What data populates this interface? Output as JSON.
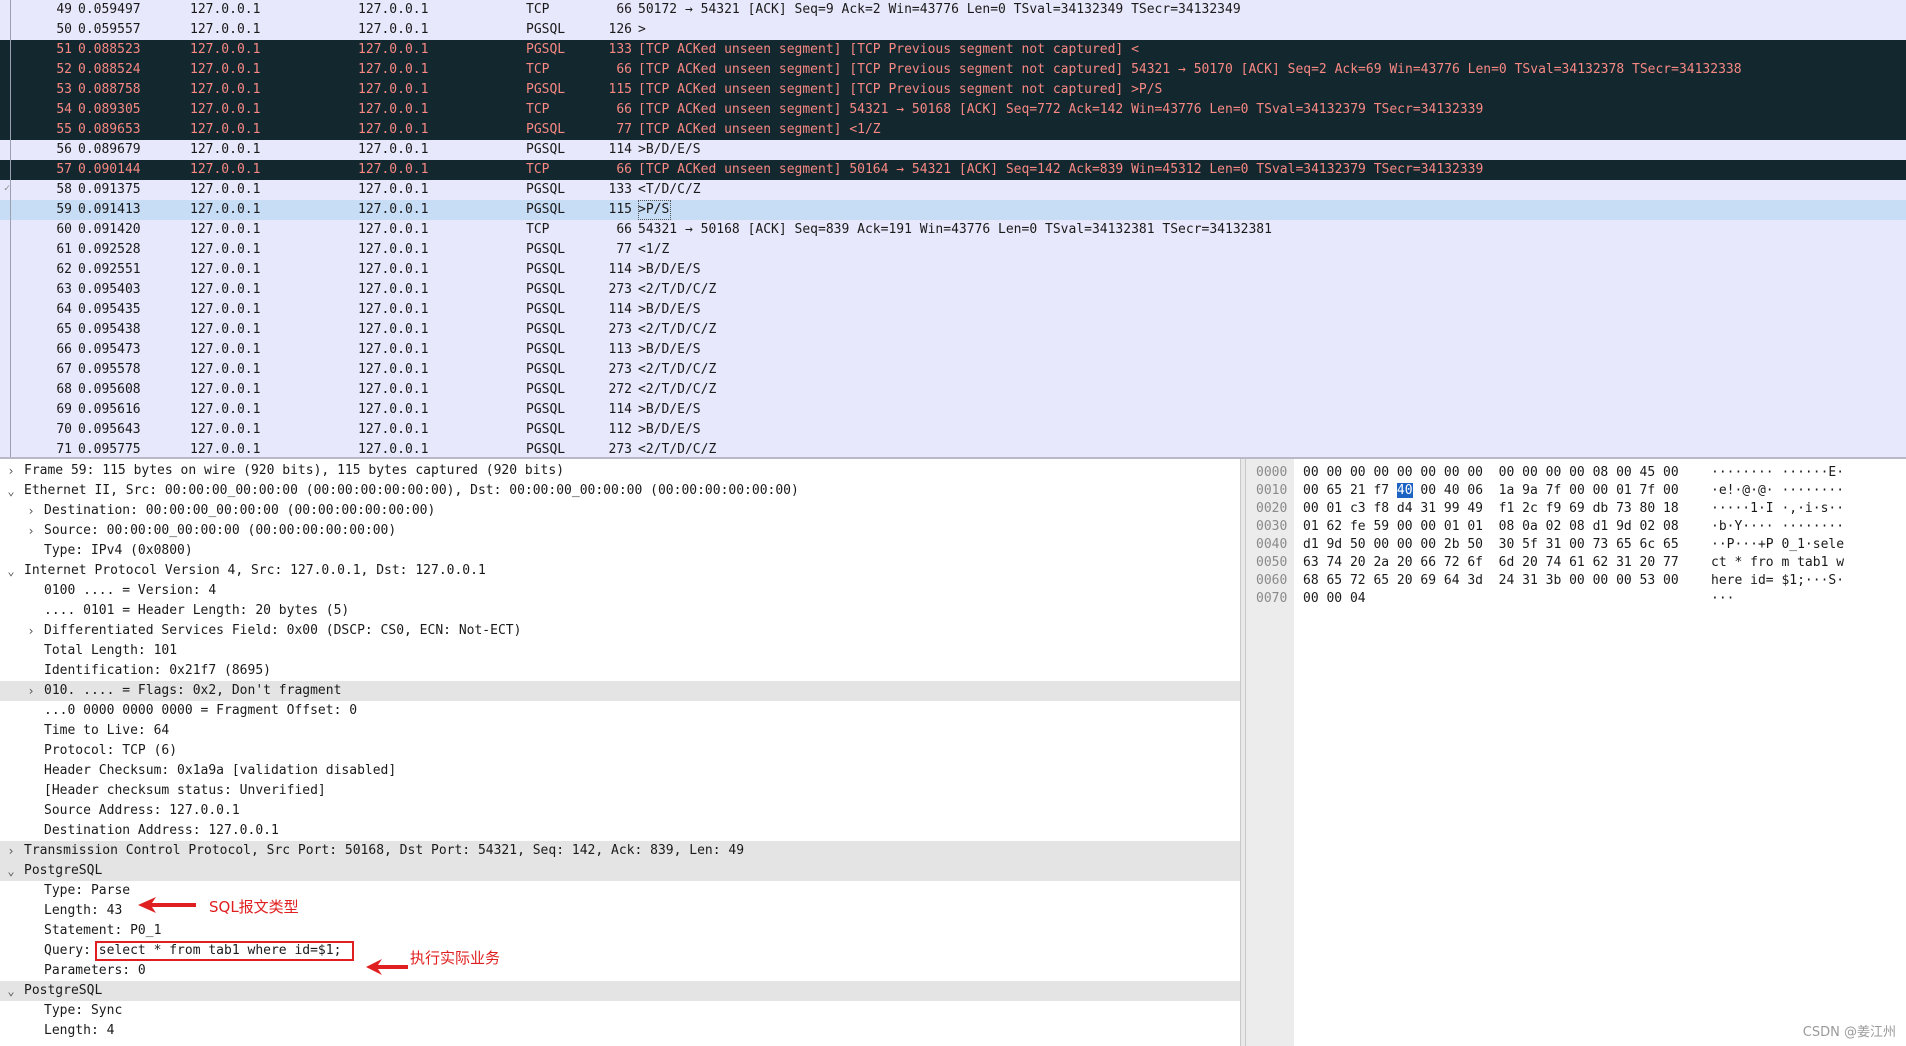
{
  "packet_list": {
    "rows": [
      {
        "no": "49",
        "time": "0.059497",
        "src": "127.0.0.1",
        "dst": "127.0.0.1",
        "proto": "TCP",
        "len": "66",
        "info": "50172 → 54321 [ACK] Seq=9 Ack=2 Win=43776 Len=0 TSval=34132349 TSecr=34132349",
        "style": "normal"
      },
      {
        "no": "50",
        "time": "0.059557",
        "src": "127.0.0.1",
        "dst": "127.0.0.1",
        "proto": "PGSQL",
        "len": "126",
        "info": ">",
        "style": "normal"
      },
      {
        "no": "51",
        "time": "0.088523",
        "src": "127.0.0.1",
        "dst": "127.0.0.1",
        "proto": "PGSQL",
        "len": "133",
        "info": "[TCP ACKed unseen segment] [TCP Previous segment not captured] <",
        "style": "dark"
      },
      {
        "no": "52",
        "time": "0.088524",
        "src": "127.0.0.1",
        "dst": "127.0.0.1",
        "proto": "TCP",
        "len": "66",
        "info": "[TCP ACKed unseen segment] [TCP Previous segment not captured] 54321 → 50170 [ACK] Seq=2 Ack=69 Win=43776 Len=0 TSval=34132378 TSecr=34132338",
        "style": "dark"
      },
      {
        "no": "53",
        "time": "0.088758",
        "src": "127.0.0.1",
        "dst": "127.0.0.1",
        "proto": "PGSQL",
        "len": "115",
        "info": "[TCP ACKed unseen segment] [TCP Previous segment not captured] >P/S",
        "style": "dark"
      },
      {
        "no": "54",
        "time": "0.089305",
        "src": "127.0.0.1",
        "dst": "127.0.0.1",
        "proto": "TCP",
        "len": "66",
        "info": "[TCP ACKed unseen segment] 54321 → 50168 [ACK] Seq=772 Ack=142 Win=43776 Len=0 TSval=34132379 TSecr=34132339",
        "style": "dark"
      },
      {
        "no": "55",
        "time": "0.089653",
        "src": "127.0.0.1",
        "dst": "127.0.0.1",
        "proto": "PGSQL",
        "len": "77",
        "info": "[TCP ACKed unseen segment] <1/Z",
        "style": "dark"
      },
      {
        "no": "56",
        "time": "0.089679",
        "src": "127.0.0.1",
        "dst": "127.0.0.1",
        "proto": "PGSQL",
        "len": "114",
        "info": ">B/D/E/S",
        "style": "normal"
      },
      {
        "no": "57",
        "time": "0.090144",
        "src": "127.0.0.1",
        "dst": "127.0.0.1",
        "proto": "TCP",
        "len": "66",
        "info": "[TCP ACKed unseen segment] 50164 → 54321 [ACK] Seq=142 Ack=839 Win=45312 Len=0 TSval=34132379 TSecr=34132339",
        "style": "dark"
      },
      {
        "no": "58",
        "time": "0.091375",
        "src": "127.0.0.1",
        "dst": "127.0.0.1",
        "proto": "PGSQL",
        "len": "133",
        "info": "<T/D/C/Z",
        "style": "normal"
      },
      {
        "no": "59",
        "time": "0.091413",
        "src": "127.0.0.1",
        "dst": "127.0.0.1",
        "proto": "PGSQL",
        "len": "115",
        "info": ">P/S",
        "style": "sel"
      },
      {
        "no": "60",
        "time": "0.091420",
        "src": "127.0.0.1",
        "dst": "127.0.0.1",
        "proto": "TCP",
        "len": "66",
        "info": "54321 → 50168 [ACK] Seq=839 Ack=191 Win=43776 Len=0 TSval=34132381 TSecr=34132381",
        "style": "normal"
      },
      {
        "no": "61",
        "time": "0.092528",
        "src": "127.0.0.1",
        "dst": "127.0.0.1",
        "proto": "PGSQL",
        "len": "77",
        "info": "<1/Z",
        "style": "normal"
      },
      {
        "no": "62",
        "time": "0.092551",
        "src": "127.0.0.1",
        "dst": "127.0.0.1",
        "proto": "PGSQL",
        "len": "114",
        "info": ">B/D/E/S",
        "style": "normal"
      },
      {
        "no": "63",
        "time": "0.095403",
        "src": "127.0.0.1",
        "dst": "127.0.0.1",
        "proto": "PGSQL",
        "len": "273",
        "info": "<2/T/D/C/Z",
        "style": "normal"
      },
      {
        "no": "64",
        "time": "0.095435",
        "src": "127.0.0.1",
        "dst": "127.0.0.1",
        "proto": "PGSQL",
        "len": "114",
        "info": ">B/D/E/S",
        "style": "normal"
      },
      {
        "no": "65",
        "time": "0.095438",
        "src": "127.0.0.1",
        "dst": "127.0.0.1",
        "proto": "PGSQL",
        "len": "273",
        "info": "<2/T/D/C/Z",
        "style": "normal"
      },
      {
        "no": "66",
        "time": "0.095473",
        "src": "127.0.0.1",
        "dst": "127.0.0.1",
        "proto": "PGSQL",
        "len": "113",
        "info": ">B/D/E/S",
        "style": "normal"
      },
      {
        "no": "67",
        "time": "0.095578",
        "src": "127.0.0.1",
        "dst": "127.0.0.1",
        "proto": "PGSQL",
        "len": "273",
        "info": "<2/T/D/C/Z",
        "style": "normal"
      },
      {
        "no": "68",
        "time": "0.095608",
        "src": "127.0.0.1",
        "dst": "127.0.0.1",
        "proto": "PGSQL",
        "len": "272",
        "info": "<2/T/D/C/Z",
        "style": "normal"
      },
      {
        "no": "69",
        "time": "0.095616",
        "src": "127.0.0.1",
        "dst": "127.0.0.1",
        "proto": "PGSQL",
        "len": "114",
        "info": ">B/D/E/S",
        "style": "normal"
      },
      {
        "no": "70",
        "time": "0.095643",
        "src": "127.0.0.1",
        "dst": "127.0.0.1",
        "proto": "PGSQL",
        "len": "112",
        "info": ">B/D/E/S",
        "style": "normal"
      },
      {
        "no": "71",
        "time": "0.095775",
        "src": "127.0.0.1",
        "dst": "127.0.0.1",
        "proto": "PGSQL",
        "len": "273",
        "info": "<2/T/D/C/Z",
        "style": "normal"
      }
    ]
  },
  "details": {
    "rows": [
      {
        "level": 0,
        "arrow": "right",
        "text": "Frame 59: 115 bytes on wire (920 bits), 115 bytes captured (920 bits)"
      },
      {
        "level": 0,
        "arrow": "down",
        "text": "Ethernet II, Src: 00:00:00_00:00:00 (00:00:00:00:00:00), Dst: 00:00:00_00:00:00 (00:00:00:00:00:00)"
      },
      {
        "level": 1,
        "arrow": "right",
        "text": "Destination: 00:00:00_00:00:00 (00:00:00:00:00:00)"
      },
      {
        "level": 1,
        "arrow": "right",
        "text": "Source: 00:00:00_00:00:00 (00:00:00:00:00:00)"
      },
      {
        "level": 1,
        "arrow": "none",
        "text": "Type: IPv4 (0x0800)"
      },
      {
        "level": 0,
        "arrow": "down",
        "text": "Internet Protocol Version 4, Src: 127.0.0.1, Dst: 127.0.0.1"
      },
      {
        "level": 1,
        "arrow": "none",
        "text": "0100 .... = Version: 4"
      },
      {
        "level": 1,
        "arrow": "none",
        "text": ".... 0101 = Header Length: 20 bytes (5)"
      },
      {
        "level": 1,
        "arrow": "right",
        "text": "Differentiated Services Field: 0x00 (DSCP: CS0, ECN: Not-ECT)"
      },
      {
        "level": 1,
        "arrow": "none",
        "text": "Total Length: 101"
      },
      {
        "level": 1,
        "arrow": "none",
        "text": "Identification: 0x21f7 (8695)"
      },
      {
        "level": 1,
        "arrow": "right",
        "text": "010. .... = Flags: 0x2, Don't fragment",
        "highlight": true
      },
      {
        "level": 1,
        "arrow": "none",
        "text": "...0 0000 0000 0000 = Fragment Offset: 0"
      },
      {
        "level": 1,
        "arrow": "none",
        "text": "Time to Live: 64"
      },
      {
        "level": 1,
        "arrow": "none",
        "text": "Protocol: TCP (6)"
      },
      {
        "level": 1,
        "arrow": "none",
        "text": "Header Checksum: 0x1a9a [validation disabled]"
      },
      {
        "level": 1,
        "arrow": "none",
        "text": "[Header checksum status: Unverified]"
      },
      {
        "level": 1,
        "arrow": "none",
        "text": "Source Address: 127.0.0.1"
      },
      {
        "level": 1,
        "arrow": "none",
        "text": "Destination Address: 127.0.0.1"
      },
      {
        "level": 0,
        "arrow": "right",
        "text": "Transmission Control Protocol, Src Port: 50168, Dst Port: 54321, Seq: 142, Ack: 839, Len: 49",
        "highlight": true
      },
      {
        "level": 0,
        "arrow": "down",
        "text": "PostgreSQL",
        "highlight": true
      },
      {
        "level": 1,
        "arrow": "none",
        "text": "Type: Parse"
      },
      {
        "level": 1,
        "arrow": "none",
        "text": "Length: 43"
      },
      {
        "level": 1,
        "arrow": "none",
        "text": "Statement: P0_1"
      },
      {
        "level": 1,
        "arrow": "none",
        "text": "Query: select * from tab1 where id=$1;"
      },
      {
        "level": 1,
        "arrow": "none",
        "text": "Parameters: 0"
      },
      {
        "level": 0,
        "arrow": "down",
        "text": "PostgreSQL",
        "highlight": true
      },
      {
        "level": 1,
        "arrow": "none",
        "text": "Type: Sync"
      },
      {
        "level": 1,
        "arrow": "none",
        "text": "Length: 4"
      }
    ]
  },
  "bytes": {
    "rows": [
      {
        "offset": "0000",
        "hex": "00 00 00 00 00 00 00 00  00 00 00 00 08 00 45 00",
        "ascii": "········ ······E·"
      },
      {
        "offset": "0010",
        "hex": "00 65 21 f7 40 00 40 06  1a 9a 7f 00 00 01 7f 00",
        "ascii": "·e!·@·@· ········"
      },
      {
        "offset": "0020",
        "hex": "00 01 c3 f8 d4 31 99 49  f1 2c f9 69 db 73 80 18",
        "ascii": "·····1·I ·,·i·s··"
      },
      {
        "offset": "0030",
        "hex": "01 62 fe 59 00 00 01 01  08 0a 02 08 d1 9d 02 08",
        "ascii": "·b·Y···· ········"
      },
      {
        "offset": "0040",
        "hex": "d1 9d 50 00 00 00 2b 50  30 5f 31 00 73 65 6c 65",
        "ascii": "··P···+P 0_1·sele"
      },
      {
        "offset": "0050",
        "hex": "63 74 20 2a 20 66 72 6f  6d 20 74 61 62 31 20 77",
        "ascii": "ct * fro m tab1 w"
      },
      {
        "offset": "0060",
        "hex": "68 65 72 65 20 69 64 3d  24 31 3b 00 00 00 53 00",
        "ascii": "here id= $1;···S·"
      },
      {
        "offset": "0070",
        "hex": "00 00 04",
        "ascii": "···"
      }
    ]
  },
  "annotations": {
    "type_label": "SQL报文类型",
    "query_label": "执行实际业务",
    "color": "#e02020"
  },
  "watermark": "CSDN @姜江州",
  "colors": {
    "list_bg": "#e8e8fc",
    "dark_row_bg": "#12272e",
    "dark_row_fg": "#f78883",
    "selected_row_bg": "#c7dcf5",
    "byte_highlight": "#1c63c4"
  }
}
